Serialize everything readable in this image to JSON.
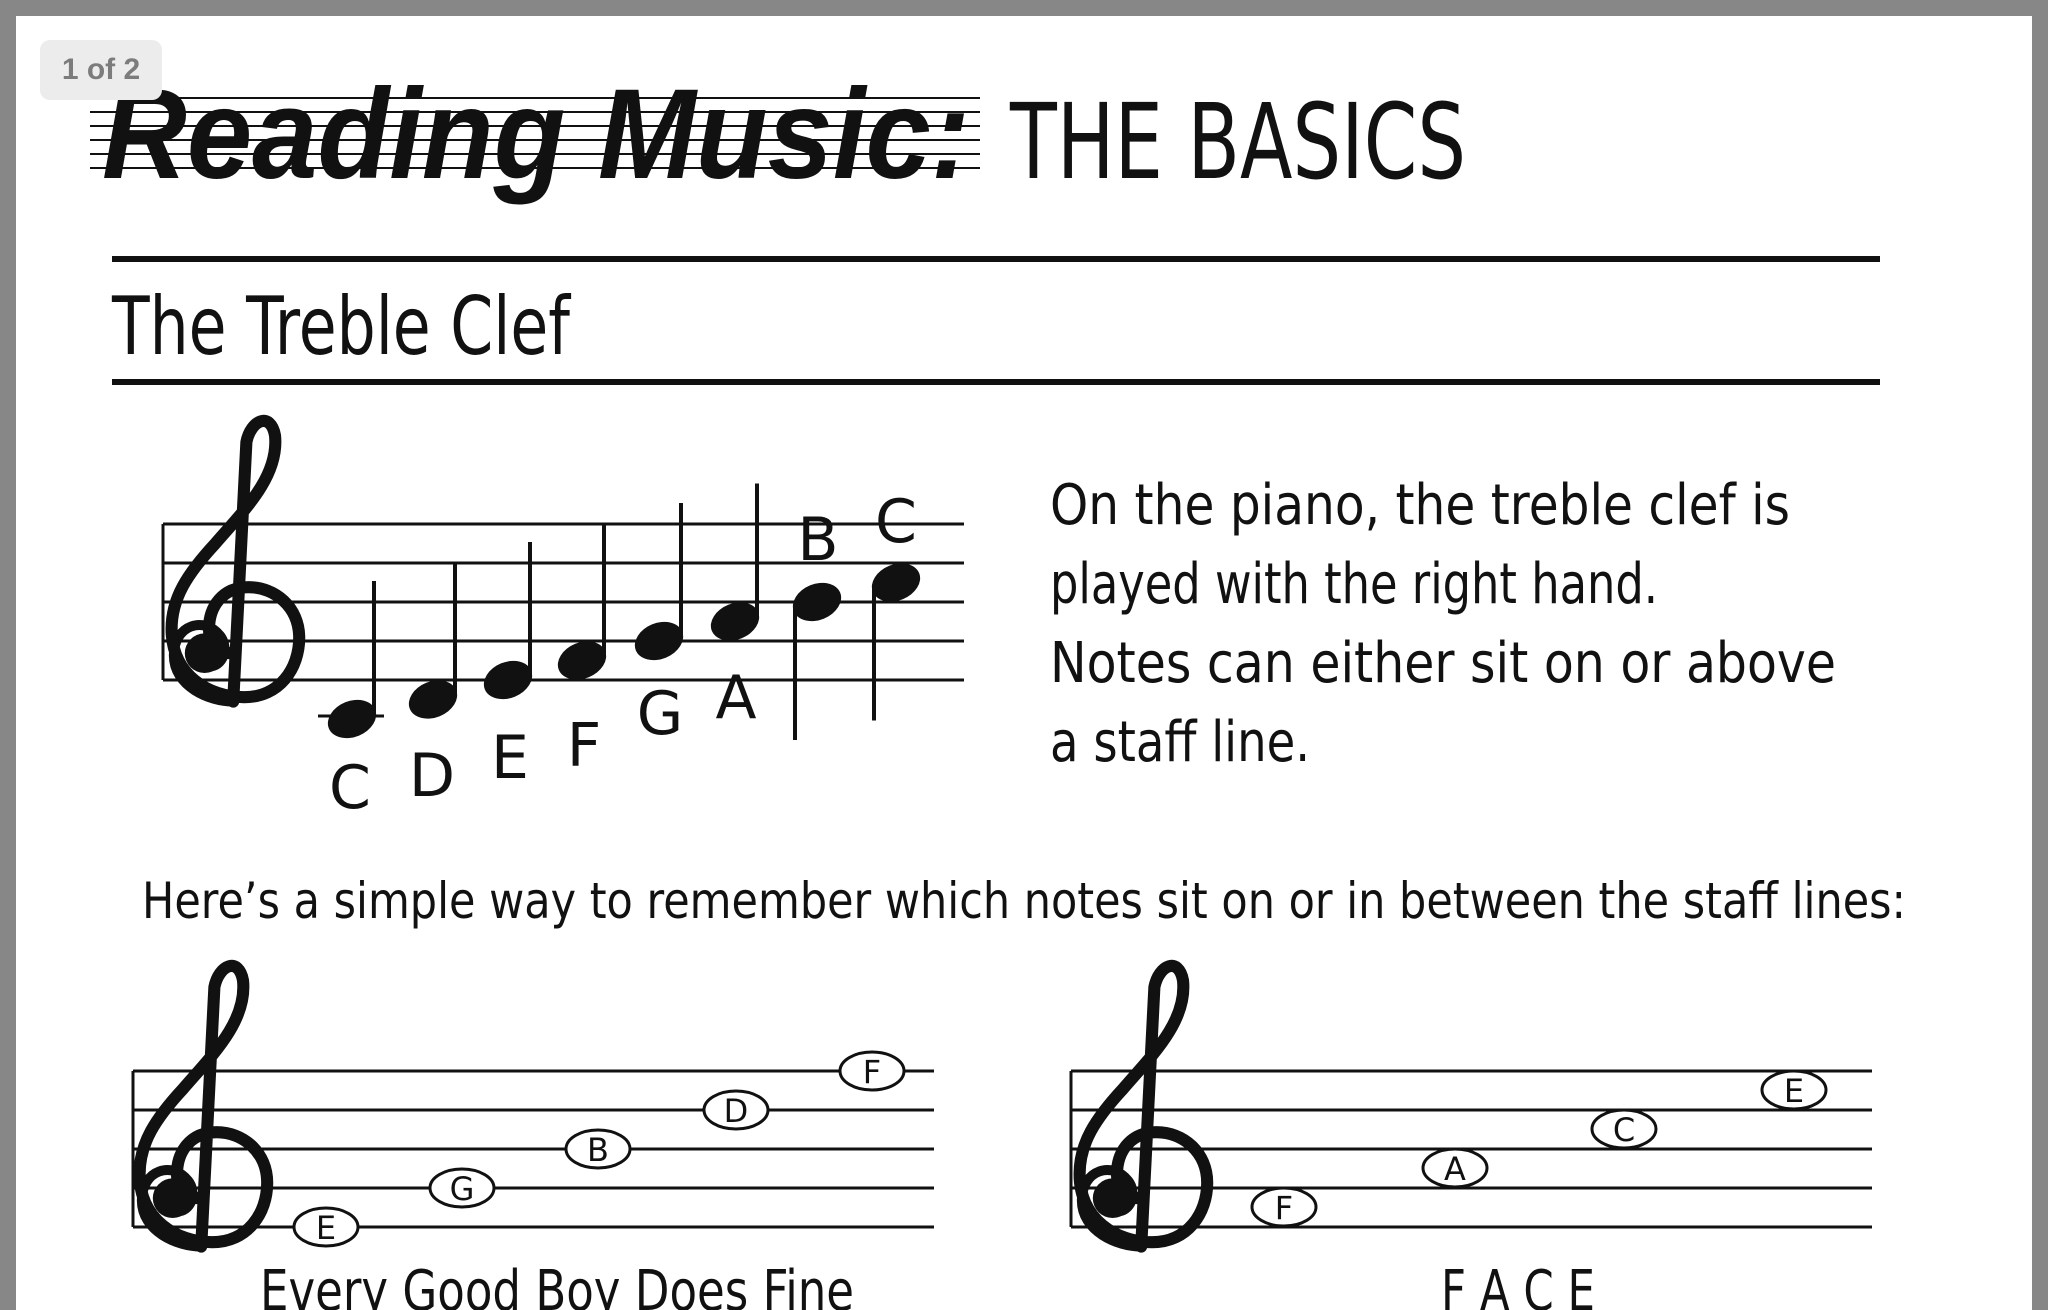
{
  "viewer": {
    "page_indicator": "1 of 2"
  },
  "header": {
    "title_script": "Reading Music:",
    "title_rest": "THE BASICS"
  },
  "section": {
    "title": "The Treble Clef"
  },
  "intro": {
    "lines": [
      "On the piano, the treble clef is",
      "played with the right hand.",
      "Notes can either sit on or above",
      "a staff line."
    ]
  },
  "scale": {
    "notes": [
      "C",
      "D",
      "E",
      "F",
      "G",
      "A",
      "B",
      "C"
    ]
  },
  "tip": "Here’s a simple way to remember which notes sit on or in between the staff lines:",
  "lines_staff": {
    "notes": [
      "E",
      "G",
      "B",
      "D",
      "F"
    ],
    "mnemonic": "Every Good Boy Does Fine"
  },
  "spaces_staff": {
    "notes": [
      "F",
      "A",
      "C",
      "E"
    ],
    "mnemonic": "F A C E"
  },
  "colors": {
    "ink": "#111111",
    "paper": "#ffffff",
    "frame": "#878787"
  }
}
